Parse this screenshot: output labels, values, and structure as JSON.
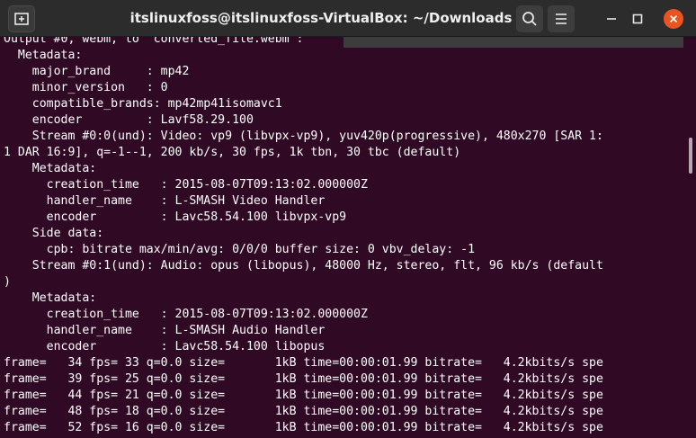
{
  "window": {
    "title": "itslinuxfoss@itslinuxfoss-VirtualBox: ~/Downloads",
    "icons": {
      "new_tab": "new-tab-icon",
      "search": "search-icon",
      "menu": "hamburger-menu-icon",
      "minimize": "minimize-icon",
      "maximize": "maximize-icon",
      "close": "close-icon"
    },
    "colors": {
      "terminal_bg": "#300a24",
      "titlebar_bg": "#2c2c2c",
      "close_button": "#e95420",
      "text": "#ffffff"
    }
  },
  "terminal": {
    "lines": [
      "Output #0, webm, to 'converted_file.webm':",
      "  Metadata:",
      "    major_brand     : mp42",
      "    minor_version   : 0",
      "    compatible_brands: mp42mp41isomavc1",
      "    encoder         : Lavf58.29.100",
      "    Stream #0:0(und): Video: vp9 (libvpx-vp9), yuv420p(progressive), 480x270 [SAR 1:",
      "1 DAR 16:9], q=-1--1, 200 kb/s, 30 fps, 1k tbn, 30 tbc (default)",
      "    Metadata:",
      "      creation_time   : 2015-08-07T09:13:02.000000Z",
      "      handler_name    : L-SMASH Video Handler",
      "      encoder         : Lavc58.54.100 libvpx-vp9",
      "    Side data:",
      "      cpb: bitrate max/min/avg: 0/0/0 buffer size: 0 vbv_delay: -1",
      "    Stream #0:1(und): Audio: opus (libopus), 48000 Hz, stereo, flt, 96 kb/s (default",
      ")",
      "    Metadata:",
      "      creation_time   : 2015-08-07T09:13:02.000000Z",
      "      handler_name    : L-SMASH Audio Handler",
      "      encoder         : Lavc58.54.100 libopus",
      "frame=   34 fps= 33 q=0.0 size=       1kB time=00:00:01.99 bitrate=   4.2kbits/s spe",
      "frame=   39 fps= 25 q=0.0 size=       1kB time=00:00:01.99 bitrate=   4.2kbits/s spe",
      "frame=   44 fps= 21 q=0.0 size=       1kB time=00:00:01.99 bitrate=   4.2kbits/s spe",
      "frame=   48 fps= 18 q=0.0 size=       1kB time=00:00:01.99 bitrate=   4.2kbits/s spe",
      "frame=   52 fps= 16 q=0.0 size=       1kB time=00:00:01.99 bitrate=   4.2kbits/s spe"
    ]
  }
}
